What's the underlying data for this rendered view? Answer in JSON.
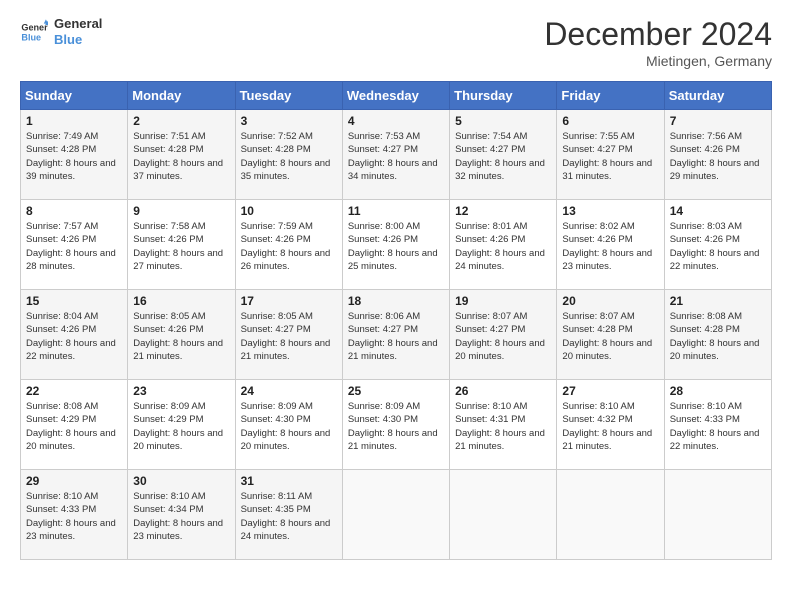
{
  "header": {
    "logo_line1": "General",
    "logo_line2": "Blue",
    "month_title": "December 2024",
    "location": "Mietingen, Germany"
  },
  "weekdays": [
    "Sunday",
    "Monday",
    "Tuesday",
    "Wednesday",
    "Thursday",
    "Friday",
    "Saturday"
  ],
  "weeks": [
    [
      {
        "day": "1",
        "sunrise": "Sunrise: 7:49 AM",
        "sunset": "Sunset: 4:28 PM",
        "daylight": "Daylight: 8 hours and 39 minutes."
      },
      {
        "day": "2",
        "sunrise": "Sunrise: 7:51 AM",
        "sunset": "Sunset: 4:28 PM",
        "daylight": "Daylight: 8 hours and 37 minutes."
      },
      {
        "day": "3",
        "sunrise": "Sunrise: 7:52 AM",
        "sunset": "Sunset: 4:28 PM",
        "daylight": "Daylight: 8 hours and 35 minutes."
      },
      {
        "day": "4",
        "sunrise": "Sunrise: 7:53 AM",
        "sunset": "Sunset: 4:27 PM",
        "daylight": "Daylight: 8 hours and 34 minutes."
      },
      {
        "day": "5",
        "sunrise": "Sunrise: 7:54 AM",
        "sunset": "Sunset: 4:27 PM",
        "daylight": "Daylight: 8 hours and 32 minutes."
      },
      {
        "day": "6",
        "sunrise": "Sunrise: 7:55 AM",
        "sunset": "Sunset: 4:27 PM",
        "daylight": "Daylight: 8 hours and 31 minutes."
      },
      {
        "day": "7",
        "sunrise": "Sunrise: 7:56 AM",
        "sunset": "Sunset: 4:26 PM",
        "daylight": "Daylight: 8 hours and 29 minutes."
      }
    ],
    [
      {
        "day": "8",
        "sunrise": "Sunrise: 7:57 AM",
        "sunset": "Sunset: 4:26 PM",
        "daylight": "Daylight: 8 hours and 28 minutes."
      },
      {
        "day": "9",
        "sunrise": "Sunrise: 7:58 AM",
        "sunset": "Sunset: 4:26 PM",
        "daylight": "Daylight: 8 hours and 27 minutes."
      },
      {
        "day": "10",
        "sunrise": "Sunrise: 7:59 AM",
        "sunset": "Sunset: 4:26 PM",
        "daylight": "Daylight: 8 hours and 26 minutes."
      },
      {
        "day": "11",
        "sunrise": "Sunrise: 8:00 AM",
        "sunset": "Sunset: 4:26 PM",
        "daylight": "Daylight: 8 hours and 25 minutes."
      },
      {
        "day": "12",
        "sunrise": "Sunrise: 8:01 AM",
        "sunset": "Sunset: 4:26 PM",
        "daylight": "Daylight: 8 hours and 24 minutes."
      },
      {
        "day": "13",
        "sunrise": "Sunrise: 8:02 AM",
        "sunset": "Sunset: 4:26 PM",
        "daylight": "Daylight: 8 hours and 23 minutes."
      },
      {
        "day": "14",
        "sunrise": "Sunrise: 8:03 AM",
        "sunset": "Sunset: 4:26 PM",
        "daylight": "Daylight: 8 hours and 22 minutes."
      }
    ],
    [
      {
        "day": "15",
        "sunrise": "Sunrise: 8:04 AM",
        "sunset": "Sunset: 4:26 PM",
        "daylight": "Daylight: 8 hours and 22 minutes."
      },
      {
        "day": "16",
        "sunrise": "Sunrise: 8:05 AM",
        "sunset": "Sunset: 4:26 PM",
        "daylight": "Daylight: 8 hours and 21 minutes."
      },
      {
        "day": "17",
        "sunrise": "Sunrise: 8:05 AM",
        "sunset": "Sunset: 4:27 PM",
        "daylight": "Daylight: 8 hours and 21 minutes."
      },
      {
        "day": "18",
        "sunrise": "Sunrise: 8:06 AM",
        "sunset": "Sunset: 4:27 PM",
        "daylight": "Daylight: 8 hours and 21 minutes."
      },
      {
        "day": "19",
        "sunrise": "Sunrise: 8:07 AM",
        "sunset": "Sunset: 4:27 PM",
        "daylight": "Daylight: 8 hours and 20 minutes."
      },
      {
        "day": "20",
        "sunrise": "Sunrise: 8:07 AM",
        "sunset": "Sunset: 4:28 PM",
        "daylight": "Daylight: 8 hours and 20 minutes."
      },
      {
        "day": "21",
        "sunrise": "Sunrise: 8:08 AM",
        "sunset": "Sunset: 4:28 PM",
        "daylight": "Daylight: 8 hours and 20 minutes."
      }
    ],
    [
      {
        "day": "22",
        "sunrise": "Sunrise: 8:08 AM",
        "sunset": "Sunset: 4:29 PM",
        "daylight": "Daylight: 8 hours and 20 minutes."
      },
      {
        "day": "23",
        "sunrise": "Sunrise: 8:09 AM",
        "sunset": "Sunset: 4:29 PM",
        "daylight": "Daylight: 8 hours and 20 minutes."
      },
      {
        "day": "24",
        "sunrise": "Sunrise: 8:09 AM",
        "sunset": "Sunset: 4:30 PM",
        "daylight": "Daylight: 8 hours and 20 minutes."
      },
      {
        "day": "25",
        "sunrise": "Sunrise: 8:09 AM",
        "sunset": "Sunset: 4:30 PM",
        "daylight": "Daylight: 8 hours and 21 minutes."
      },
      {
        "day": "26",
        "sunrise": "Sunrise: 8:10 AM",
        "sunset": "Sunset: 4:31 PM",
        "daylight": "Daylight: 8 hours and 21 minutes."
      },
      {
        "day": "27",
        "sunrise": "Sunrise: 8:10 AM",
        "sunset": "Sunset: 4:32 PM",
        "daylight": "Daylight: 8 hours and 21 minutes."
      },
      {
        "day": "28",
        "sunrise": "Sunrise: 8:10 AM",
        "sunset": "Sunset: 4:33 PM",
        "daylight": "Daylight: 8 hours and 22 minutes."
      }
    ],
    [
      {
        "day": "29",
        "sunrise": "Sunrise: 8:10 AM",
        "sunset": "Sunset: 4:33 PM",
        "daylight": "Daylight: 8 hours and 23 minutes."
      },
      {
        "day": "30",
        "sunrise": "Sunrise: 8:10 AM",
        "sunset": "Sunset: 4:34 PM",
        "daylight": "Daylight: 8 hours and 23 minutes."
      },
      {
        "day": "31",
        "sunrise": "Sunrise: 8:11 AM",
        "sunset": "Sunset: 4:35 PM",
        "daylight": "Daylight: 8 hours and 24 minutes."
      },
      null,
      null,
      null,
      null
    ]
  ]
}
